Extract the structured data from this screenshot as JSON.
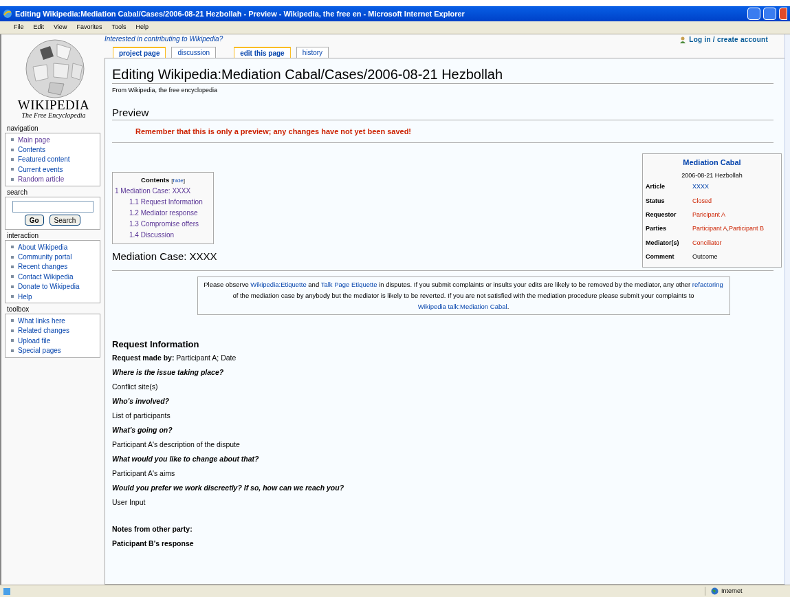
{
  "window": {
    "title": "Editing Wikipedia:Mediation Cabal/Cases/2006-08-21 Hezbollah - Preview - Wikipedia, the free en - Microsoft Internet Explorer"
  },
  "menu": [
    "File",
    "Edit",
    "View",
    "Favorites",
    "Tools",
    "Help"
  ],
  "logo": {
    "wordmark": "WIKIPEDIA",
    "tagline": "The Free Encyclopedia"
  },
  "sidebar": [
    {
      "title": "navigation",
      "items": [
        {
          "label": "Main page",
          "visited": true
        },
        {
          "label": "Contents",
          "visited": false
        },
        {
          "label": "Featured content",
          "visited": false
        },
        {
          "label": "Current events",
          "visited": false
        },
        {
          "label": "Random article",
          "visited": true
        }
      ]
    },
    {
      "title": "search",
      "kind": "search",
      "buttons": [
        "Go",
        "Search"
      ]
    },
    {
      "title": "interaction",
      "items": [
        {
          "label": "About Wikipedia",
          "visited": false
        },
        {
          "label": "Community portal",
          "visited": false
        },
        {
          "label": "Recent changes",
          "visited": false
        },
        {
          "label": "Contact Wikipedia",
          "visited": false
        },
        {
          "label": "Donate to Wikipedia",
          "visited": false
        },
        {
          "label": "Help",
          "visited": false
        }
      ]
    },
    {
      "title": "toolbox",
      "items": [
        {
          "label": "What links here",
          "visited": false
        },
        {
          "label": "Related changes",
          "visited": false
        },
        {
          "label": "Upload file",
          "visited": false
        },
        {
          "label": "Special pages",
          "visited": false
        }
      ]
    }
  ],
  "sitenotice": "Interested in contributing to Wikipedia?",
  "tabs": [
    {
      "label": "project page",
      "selected": true
    },
    {
      "label": "discussion",
      "selected": false
    },
    {
      "label": "edit this page",
      "selected": true
    },
    {
      "label": "history",
      "selected": false
    }
  ],
  "login": "Log in / create account",
  "heading": "Editing Wikipedia:Mediation Cabal/Cases/2006-08-21 Hezbollah",
  "subtitle": "From Wikipedia, the free encyclopedia",
  "preview_heading": "Preview",
  "preview_warning": "Remember that this is only a preview; any changes have not yet been saved!",
  "toc": {
    "title": "Contents",
    "toggle": {
      "open": "[",
      "label": "hide",
      "close": "]"
    },
    "items": [
      {
        "label": "1 Mediation Case: XXXX",
        "children": [
          {
            "label": "1.1 Request Information"
          },
          {
            "label": "1.2 Mediator response"
          },
          {
            "label": "1.3 Compromise offers"
          },
          {
            "label": "1.4 Discussion"
          }
        ]
      }
    ]
  },
  "infobox": {
    "title": "Mediation Cabal",
    "subtitle": "2006-08-21 Hezbollah",
    "rows": [
      {
        "label": "Article",
        "value": [
          {
            "text": "XXXX",
            "kind": "link"
          }
        ]
      },
      {
        "label": "Status",
        "value": [
          {
            "text": "Closed",
            "kind": "redlink"
          }
        ]
      },
      {
        "label": "Requestor",
        "value": [
          {
            "text": "Paricipant A",
            "kind": "redlink"
          }
        ]
      },
      {
        "label": "Parties",
        "value": [
          {
            "text": "Participant A",
            "kind": "redlink"
          },
          {
            "text": ",",
            "kind": "plain"
          },
          {
            "text": "Participant B",
            "kind": "redlink"
          }
        ]
      },
      {
        "label": "Mediator(s)",
        "value": [
          {
            "text": "Conciliator",
            "kind": "redlink"
          }
        ]
      },
      {
        "label": "Comment",
        "value": [
          {
            "text": "Outcome",
            "kind": "plain"
          }
        ]
      }
    ]
  },
  "section_heading": "Mediation Case: XXXX",
  "notice": [
    {
      "text": "Please observe ",
      "link": false
    },
    {
      "text": "Wikipedia:Etiquette",
      "link": true
    },
    {
      "text": " and ",
      "link": false
    },
    {
      "text": "Talk Page Etiquette",
      "link": true
    },
    {
      "text": " in disputes. If you submit complaints or insults your edits are likely to be removed by the mediator, any other ",
      "link": false
    },
    {
      "text": "refactoring",
      "link": true
    },
    {
      "text": " of the mediation case by anybody but the mediator is likely to be reverted. If you are not satisfied with the mediation procedure please submit your complaints to ",
      "link": false
    },
    {
      "text": "Wikipedia talk:Mediation Cabal",
      "link": true
    }
  ],
  "notice_end": ".",
  "subsection_heading": "Request Information",
  "body": [
    {
      "kind": "answer",
      "text": "**Request made by:** Participant A; Date"
    },
    {
      "kind": "question",
      "text": "Where is the issue taking place?"
    },
    {
      "kind": "answer",
      "text": "Conflict site(s)"
    },
    {
      "kind": "question",
      "text": "Who's involved?"
    },
    {
      "kind": "answer",
      "text": "List of participants"
    },
    {
      "kind": "question",
      "text": "What's going on?"
    },
    {
      "kind": "answer",
      "text": "Participant A's description of the dispute"
    },
    {
      "kind": "question",
      "text": "What would you like to change about that?"
    },
    {
      "kind": "answer",
      "text": "Participant A's aims"
    },
    {
      "kind": "question",
      "text": "Would you prefer we work discreetly? If so, how can we reach you?"
    },
    {
      "kind": "answer",
      "text": "User Input"
    },
    {
      "kind": "strong",
      "text": "Notes from other party:"
    },
    {
      "kind": "strong",
      "text": "Paticipant B's response"
    }
  ],
  "status_bar": {
    "zone": "Internet"
  }
}
